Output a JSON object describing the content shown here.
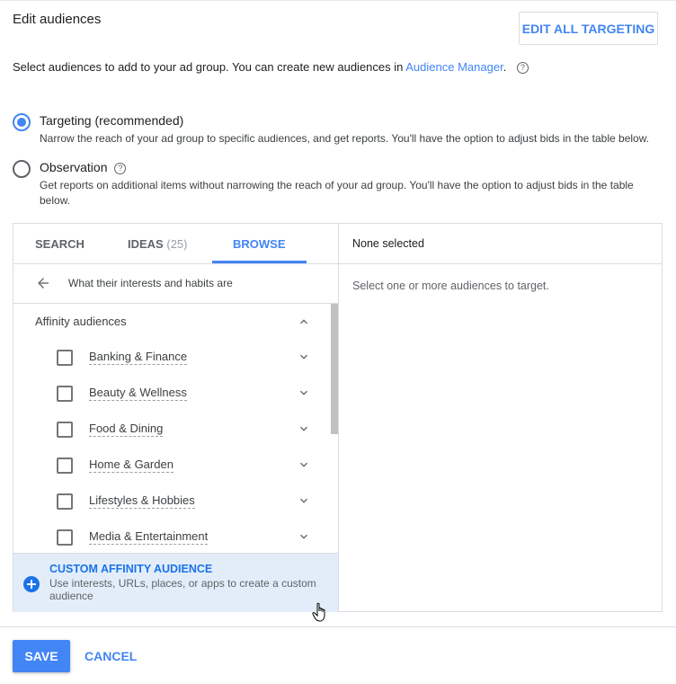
{
  "header": {
    "title": "Edit audiences",
    "edit_all_label": "EDIT ALL TARGETING"
  },
  "intro": {
    "text": "Select audiences to add to your ad group. You can create new audiences in ",
    "link": "Audience Manager",
    "trailing": ".",
    "help_icon": "help-circle-icon"
  },
  "targeting_options": [
    {
      "label": "Targeting (recommended)",
      "description": "Narrow the reach of your ad group to specific audiences, and get reports. You'll have the option to adjust bids in the table below.",
      "selected": true
    },
    {
      "label": "Observation",
      "description": "Get reports on additional items without narrowing the reach of your ad group. You'll have the option to adjust bids in the table below.",
      "selected": false,
      "has_help": true
    }
  ],
  "tabs": [
    {
      "label": "SEARCH",
      "count": ""
    },
    {
      "label": "IDEAS",
      "count": "(25)"
    },
    {
      "label": "BROWSE",
      "count": "",
      "active": true
    }
  ],
  "breadcrumb": {
    "back_icon": "arrow-left-icon",
    "label": "What their interests and habits are"
  },
  "group": {
    "header": "Affinity audiences",
    "expanded": true,
    "items": [
      {
        "label": "Banking & Finance",
        "checked": false
      },
      {
        "label": "Beauty & Wellness",
        "checked": false
      },
      {
        "label": "Food & Dining",
        "checked": false
      },
      {
        "label": "Home & Garden",
        "checked": false
      },
      {
        "label": "Lifestyles & Hobbies",
        "checked": false
      },
      {
        "label": "Media & Entertainment",
        "checked": false
      }
    ]
  },
  "custom_affinity": {
    "title": "CUSTOM AFFINITY AUDIENCE",
    "description": "Use interests, URLs, places, or apps to create a custom audience",
    "icon": "plus-circle-icon"
  },
  "selection_panel": {
    "header": "None selected",
    "hint": "Select one or more audiences to target."
  },
  "footer": {
    "save_label": "SAVE",
    "cancel_label": "CANCEL"
  },
  "colors": {
    "accent": "#4285f4",
    "custom_bg": "#e3edf9"
  }
}
